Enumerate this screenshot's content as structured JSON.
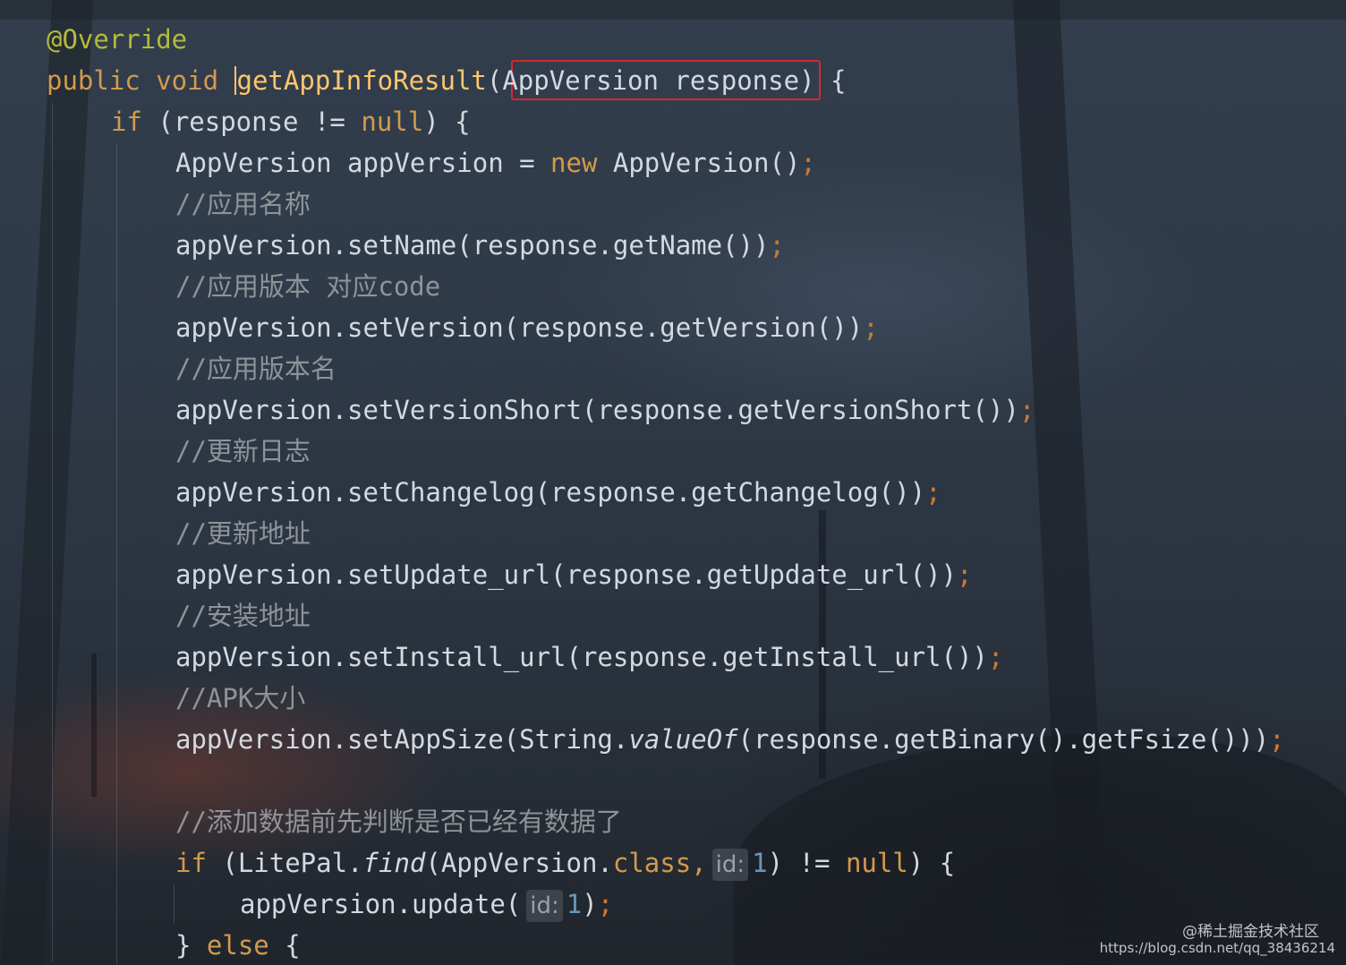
{
  "editor": {
    "lines": [
      {
        "tokens": [
          {
            "t": "@Override",
            "c": "ann"
          }
        ]
      },
      {
        "tokens": [
          {
            "t": "public void ",
            "c": "kw"
          },
          {
            "t": "|caret",
            "c": "caret"
          },
          {
            "t": "getAppInfoResult",
            "c": "fn"
          },
          {
            "t": "(AppVersion response) {",
            "c": ""
          }
        ]
      },
      {
        "tokens": [
          {
            "t": "if",
            "c": "kw"
          },
          {
            "t": " (response != ",
            "c": ""
          },
          {
            "t": "null",
            "c": "kw"
          },
          {
            "t": ") {",
            "c": ""
          }
        ]
      },
      {
        "tokens": [
          {
            "t": "AppVersion appVersion = ",
            "c": ""
          },
          {
            "t": "new",
            "c": "kw"
          },
          {
            "t": " AppVersion()",
            "c": ""
          },
          {
            "t": ";",
            "c": "semi"
          }
        ]
      },
      {
        "tokens": [
          {
            "t": "//应用名称",
            "c": "cm"
          }
        ]
      },
      {
        "tokens": [
          {
            "t": "appVersion.setName(response.getName())",
            "c": ""
          },
          {
            "t": ";",
            "c": "semi"
          }
        ]
      },
      {
        "tokens": [
          {
            "t": "//应用版本 对应code",
            "c": "cm"
          }
        ]
      },
      {
        "tokens": [
          {
            "t": "appVersion.setVersion(response.getVersion())",
            "c": ""
          },
          {
            "t": ";",
            "c": "semi"
          }
        ]
      },
      {
        "tokens": [
          {
            "t": "//应用版本名",
            "c": "cm"
          }
        ]
      },
      {
        "tokens": [
          {
            "t": "appVersion.setVersionShort(response.getVersionShort())",
            "c": ""
          },
          {
            "t": ";",
            "c": "semi"
          }
        ]
      },
      {
        "tokens": [
          {
            "t": "//更新日志",
            "c": "cm"
          }
        ]
      },
      {
        "tokens": [
          {
            "t": "appVersion.setChangelog(response.getChangelog())",
            "c": ""
          },
          {
            "t": ";",
            "c": "semi"
          }
        ]
      },
      {
        "tokens": [
          {
            "t": "//更新地址",
            "c": "cm"
          }
        ]
      },
      {
        "tokens": [
          {
            "t": "appVersion.setUpdate_url(response.getUpdate_url())",
            "c": ""
          },
          {
            "t": ";",
            "c": "semi"
          }
        ]
      },
      {
        "tokens": [
          {
            "t": "//安装地址",
            "c": "cm"
          }
        ]
      },
      {
        "tokens": [
          {
            "t": "appVersion.setInstall_url(response.getInstall_url())",
            "c": ""
          },
          {
            "t": ";",
            "c": "semi"
          }
        ]
      },
      {
        "tokens": [
          {
            "t": "//APK大小",
            "c": "cm"
          }
        ]
      },
      {
        "tokens": [
          {
            "t": "appVersion.setAppSize(String.",
            "c": ""
          },
          {
            "t": "valueOf",
            "c": "it"
          },
          {
            "t": "(response.getBinary().getFsize()))",
            "c": ""
          },
          {
            "t": ";",
            "c": "semi"
          }
        ]
      },
      {
        "tokens": []
      },
      {
        "tokens": [
          {
            "t": "//添加数据前先判断是否已经有数据了",
            "c": "cm"
          }
        ]
      },
      {
        "tokens": [
          {
            "t": "if",
            "c": "kw"
          },
          {
            "t": " (LitePal.",
            "c": ""
          },
          {
            "t": "find",
            "c": "it"
          },
          {
            "t": "(AppVersion.",
            "c": ""
          },
          {
            "t": "class",
            "c": "kw"
          },
          {
            "t": ",",
            "c": "kw"
          },
          {
            "t": "id:",
            "c": "hint"
          },
          {
            "t": "1",
            "c": "num"
          },
          {
            "t": ") != ",
            "c": ""
          },
          {
            "t": "null",
            "c": "kw"
          },
          {
            "t": ") {",
            "c": ""
          }
        ]
      },
      {
        "tokens": [
          {
            "t": "appVersion.update(",
            "c": ""
          },
          {
            "t": "id:",
            "c": "hint"
          },
          {
            "t": "1",
            "c": "num"
          },
          {
            "t": ")",
            "c": ""
          },
          {
            "t": ";",
            "c": "semi"
          }
        ]
      },
      {
        "tokens": [
          {
            "t": "} ",
            "c": ""
          },
          {
            "t": "else",
            "c": "kw"
          },
          {
            "t": " {",
            "c": ""
          }
        ]
      }
    ]
  },
  "watermark": {
    "site": "@稀土掘金技术社区",
    "url": "https://blog.csdn.net/qq_38436214"
  }
}
